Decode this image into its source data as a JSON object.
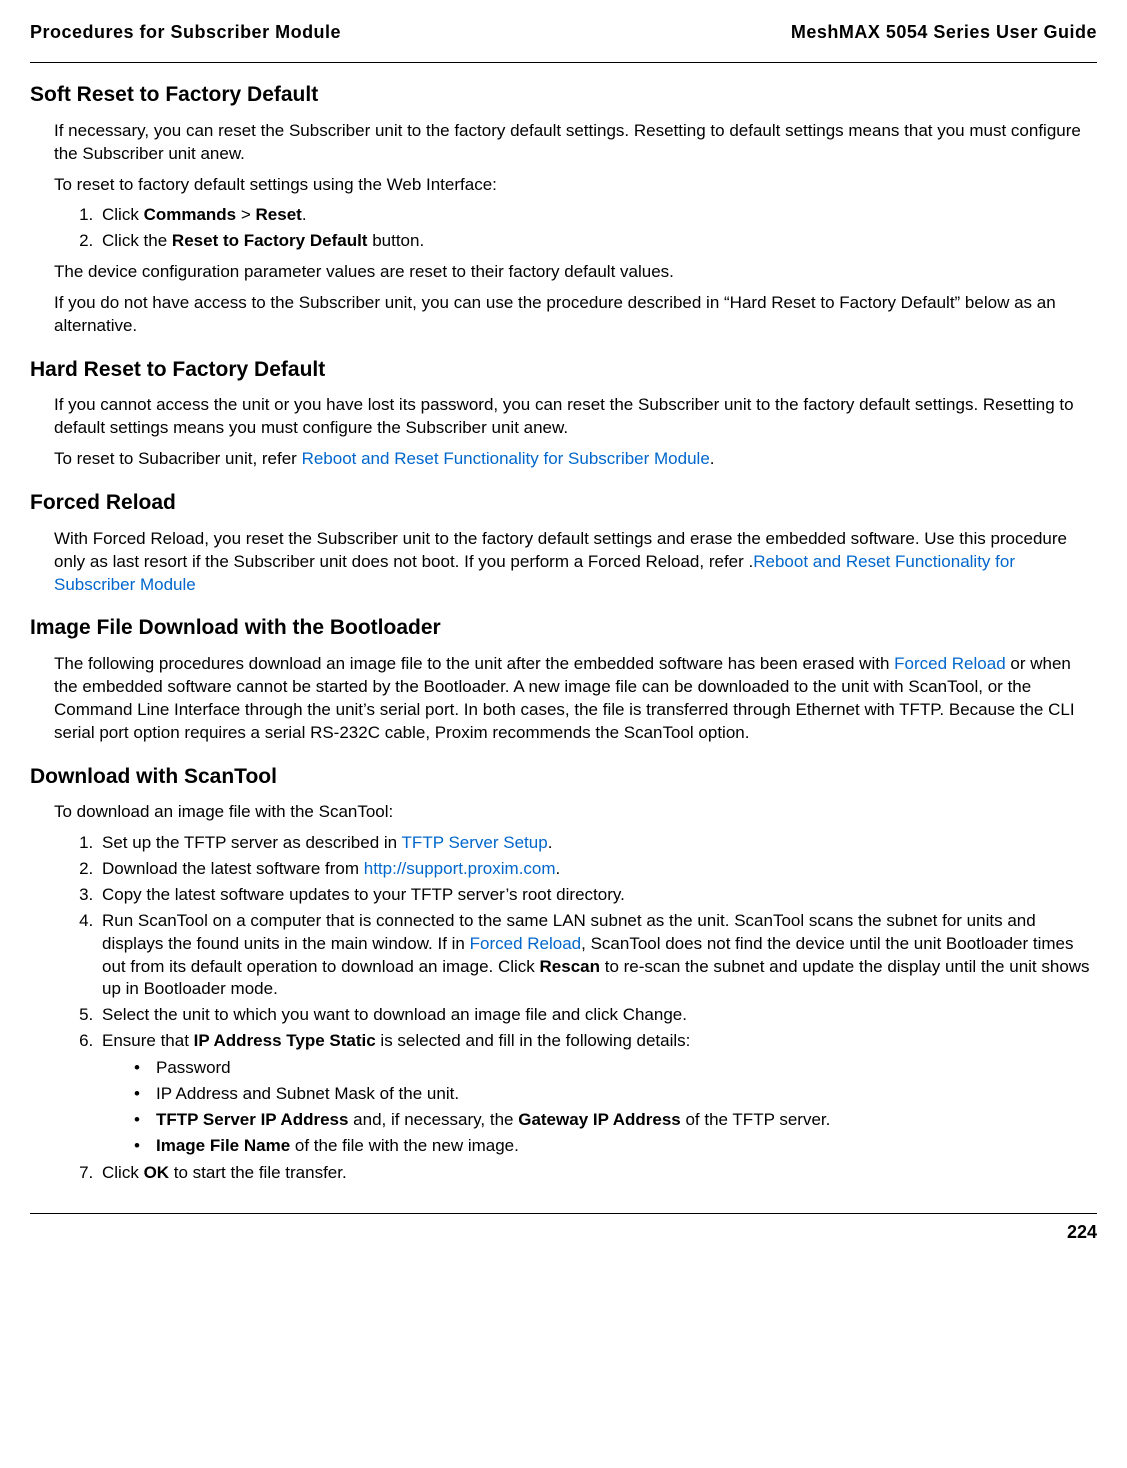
{
  "header": {
    "left": "Procedures for Subscriber Module",
    "right": "MeshMAX 5054 Series User Guide"
  },
  "sections": {
    "soft_reset": {
      "title": "Soft Reset to Factory Default",
      "p1": "If necessary, you can reset the Subscriber unit to the factory default settings. Resetting to default settings means that you must configure the Subscriber unit anew.",
      "p2": "To reset to factory default settings using the Web Interface:",
      "li1_a": "Click ",
      "li1_b": "Commands",
      "li1_c": " > ",
      "li1_d": "Reset",
      "li1_e": ".",
      "li2_a": "Click the ",
      "li2_b": "Reset to Factory Default",
      "li2_c": " button.",
      "p3": "The device configuration parameter values are reset to their factory default values.",
      "p4": "If you do not have access to the Subscriber unit, you can use the procedure described in “Hard Reset to Factory Default” below as an alternative."
    },
    "hard_reset": {
      "title": "Hard Reset to Factory Default",
      "p1": "If you cannot access the unit or you have lost its password, you can reset the Subscriber unit to the factory default settings. Resetting to default settings means you must configure the Subscriber unit anew.",
      "p2_a": "To reset to Subacriber unit, refer ",
      "p2_link": "Reboot and Reset Functionality for Subscriber Module",
      "p2_b": "."
    },
    "forced_reload": {
      "title": "Forced Reload",
      "p1_a": "With Forced Reload, you reset the Subscriber unit to the factory default settings and erase the embedded software. Use this procedure only as last resort if the Subscriber unit does not boot. If you perform a Forced Reload, refer .",
      "p1_link": "Reboot and Reset Functionality for Subscriber Module"
    },
    "image_dl": {
      "title": "Image File Download with the Bootloader",
      "p1_a": "The following procedures download an image file to the unit after the embedded software has been erased with ",
      "p1_link": "Forced Reload",
      "p1_b": " or when the embedded software cannot be started by the Bootloader. A new image file can be downloaded to the unit with ScanTool, or the Command Line Interface through the unit’s serial port. In both cases, the file is transferred through Ethernet with TFTP. Because the CLI serial port option requires a serial RS-232C cable, Proxim recommends the ScanTool option."
    },
    "dl_scantool": {
      "title": "Download with ScanTool",
      "p1": "To download an image file with the ScanTool:",
      "li1_a": "Set up the TFTP server as described in ",
      "li1_link": "TFTP Server Setup",
      "li1_b": ".",
      "li2_a": "Download the latest software from ",
      "li2_link": "http://support.proxim.com",
      "li2_b": ".",
      "li3": "Copy the latest software updates to your TFTP server’s root directory.",
      "li4_a": "Run ScanTool on a computer that is connected to the same LAN subnet as the unit. ScanTool scans the subnet for units and displays the found units in the main window. If in ",
      "li4_link": "Forced Reload",
      "li4_b": ", ScanTool does not find the device until the unit Bootloader times out from its default operation to download an image. Click ",
      "li4_bold": "Rescan",
      "li4_c": " to re-scan the subnet and update the display until the unit shows up in Bootloader mode.",
      "li5": "Select the unit to which you want to download an image file and click Change.",
      "li6_a": "Ensure that ",
      "li6_bold": "IP Address Type Static",
      "li6_b": " is selected and fill in the following details:",
      "b1": "Password",
      "b2": "IP Address and Subnet Mask of the unit.",
      "b3_bold1": "TFTP Server IP Address",
      "b3_mid": " and, if necessary, the ",
      "b3_bold2": "Gateway IP Address",
      "b3_end": " of the TFTP server.",
      "b4_bold": "Image File Name",
      "b4_end": " of the file with the new image.",
      "li7_a": "Click ",
      "li7_bold": "OK",
      "li7_b": " to start the file transfer."
    }
  },
  "footer": {
    "page": "224"
  }
}
